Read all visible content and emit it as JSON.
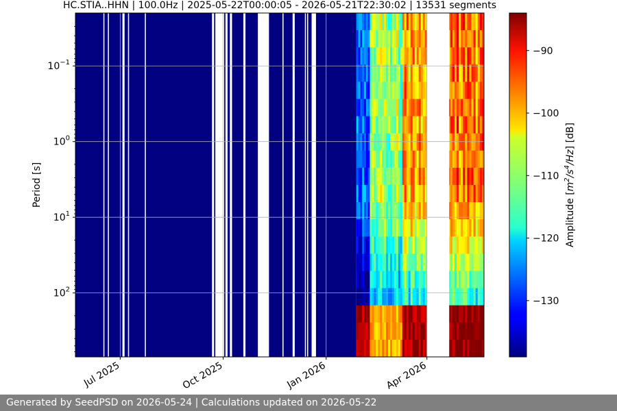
{
  "chart_data": {
    "type": "heatmap",
    "title": "HC.STIA..HHN | 100.0Hz | 2025-05-22T00:00:05 - 2026-05-21T22:30:02 | 13531 segments",
    "xlabel": "",
    "ylabel": "Period [s]",
    "x_type": "date",
    "xlim": [
      "2025-05-22",
      "2026-05-22"
    ],
    "x_ticks": [
      {
        "date": "2025-07-01",
        "label": "Jul 2025"
      },
      {
        "date": "2025-10-01",
        "label": "Oct 2025"
      },
      {
        "date": "2026-01-01",
        "label": "Jan 2026"
      },
      {
        "date": "2026-04-01",
        "label": "Apr 2026"
      }
    ],
    "y_scale": "log",
    "y_inverted": true,
    "ylim": [
      0.02,
      700
    ],
    "y_ticks": [
      {
        "value": 0.1,
        "base": "10",
        "exp": "−1"
      },
      {
        "value": 1,
        "base": "10",
        "exp": "0"
      },
      {
        "value": 10,
        "base": "10",
        "exp": "1"
      },
      {
        "value": 100,
        "base": "10",
        "exp": "2"
      }
    ],
    "grid": true,
    "colormap": "jet",
    "colorbar": {
      "label_parts": [
        {
          "t": "Amplitude [",
          "i": false
        },
        {
          "t": "m",
          "i": true
        },
        {
          "t": "2",
          "sup": true,
          "i": true
        },
        {
          "t": "/s",
          "i": true
        },
        {
          "t": "4",
          "sup": true,
          "i": true
        },
        {
          "t": "/Hz",
          "i": true
        },
        {
          "t": "] [dB]",
          "i": false
        }
      ],
      "range": [
        -139,
        -84
      ],
      "ticks": [
        -90,
        -100,
        -110,
        -120,
        -130
      ]
    },
    "data_gaps": [
      [
        "2025-06-16",
        "2025-06-16"
      ],
      [
        "2025-06-20",
        "2025-06-20"
      ],
      [
        "2025-07-03",
        "2025-07-04"
      ],
      [
        "2025-07-08",
        "2025-07-08"
      ],
      [
        "2025-07-23",
        "2025-07-23"
      ],
      [
        "2025-09-21",
        "2025-09-22"
      ],
      [
        "2025-09-24",
        "2025-10-01"
      ],
      [
        "2025-10-03",
        "2025-10-04"
      ],
      [
        "2025-10-07",
        "2025-10-08"
      ],
      [
        "2025-10-19",
        "2025-10-20"
      ],
      [
        "2025-11-01",
        "2025-11-10"
      ],
      [
        "2025-11-23",
        "2025-11-23"
      ],
      [
        "2025-12-02",
        "2025-12-03"
      ],
      [
        "2025-12-13",
        "2025-12-13"
      ],
      [
        "2025-12-15",
        "2025-12-15"
      ],
      [
        "2025-12-19",
        "2025-12-22"
      ],
      [
        "2026-04-01",
        "2026-04-20"
      ]
    ],
    "segments": [
      {
        "start": "2025-05-22",
        "end": "2026-01-28",
        "level_short": -139,
        "level_long": -139,
        "level_micro": -139
      },
      {
        "start": "2026-01-28",
        "end": "2026-02-09",
        "level_short": -125,
        "level_long": -139,
        "level_micro": -86
      },
      {
        "start": "2026-02-09",
        "end": "2026-03-10",
        "level_short": -110,
        "level_long": -122,
        "level_micro": -100
      },
      {
        "start": "2026-03-10",
        "end": "2026-04-01",
        "level_short": -100,
        "level_long": -120,
        "level_micro": -86
      },
      {
        "start": "2026-04-20",
        "end": "2026-05-22",
        "level_short": -97,
        "level_long": -118,
        "level_micro": -85
      }
    ],
    "annotations": []
  },
  "footer": {
    "text": "Generated by SeedPSD on 2026-05-24 | Calculations updated on 2026-05-22"
  }
}
